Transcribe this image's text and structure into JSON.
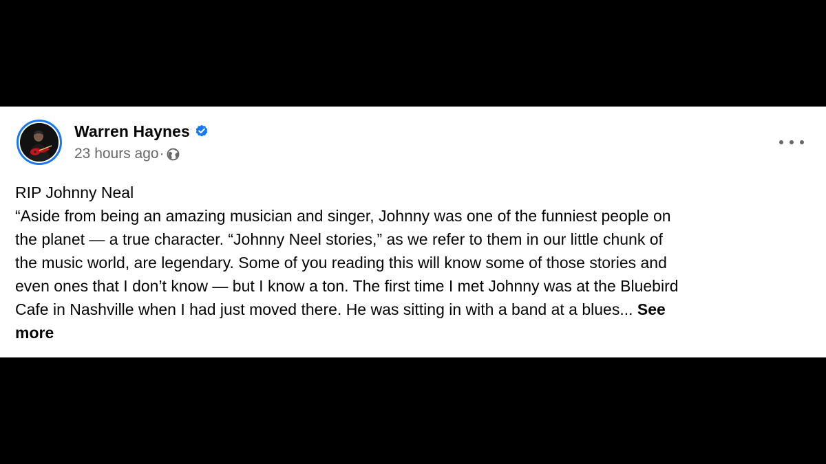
{
  "post": {
    "author": "Warren Haynes",
    "timestamp": "23 hours ago",
    "separator": "·",
    "icons": {
      "verified": "verified-badge-icon",
      "audience": "globe-icon",
      "menu": "more-options-icon"
    },
    "colors": {
      "verified": "#1877f2",
      "meta": "#65676b",
      "text": "#050505"
    },
    "lines": [
      "RIP Johnny Neal",
      "“Aside from being an amazing musician and singer, Johnny was one of the funniest people on",
      "the planet — a true character. “Johnny Neel stories,” as we refer to them in our little chunk of",
      "the music world, are legendary. Some of you reading this will know some of those stories and",
      "even ones that I don’t know — but I know a ton. The first time I met Johnny was at the Bluebird",
      "Cafe in Nashville when I had just moved there. He was sitting in with a band at a blues... "
    ],
    "see_more_part1": "See",
    "see_more_part2": "more"
  }
}
